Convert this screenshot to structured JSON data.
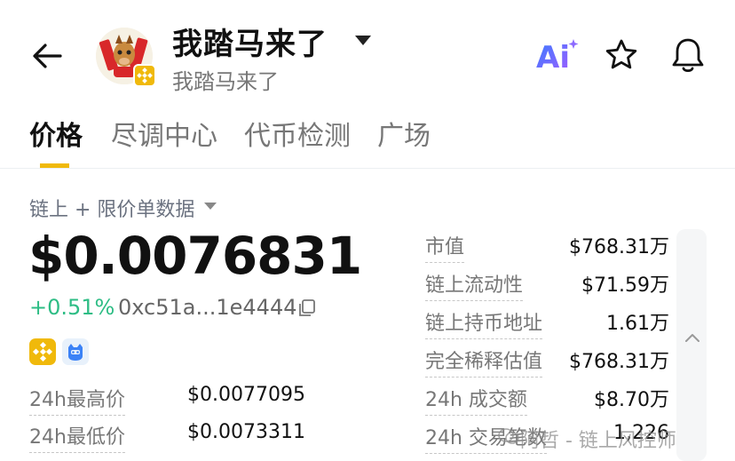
{
  "header": {
    "title": "我踏马来了",
    "subtitle": "我踏马来了",
    "ai_label": "Ai"
  },
  "tabs": [
    {
      "label": "价格",
      "active": true
    },
    {
      "label": "尽调中心",
      "active": false
    },
    {
      "label": "代币检测",
      "active": false
    },
    {
      "label": "广场",
      "active": false
    }
  ],
  "source_label": "链上 + 限价单数据",
  "price": "$0.0076831",
  "change": "+0.51%",
  "address": "0xc51a...1e4444",
  "left_stats": [
    {
      "label": "24h最高价",
      "value": "$0.0077095"
    },
    {
      "label": "24h最低价",
      "value": "$0.0073311"
    }
  ],
  "right_stats": [
    {
      "label": "市值",
      "value": "$768.31万"
    },
    {
      "label": "链上流动性",
      "value": "$71.59万"
    },
    {
      "label": "链上持币地址",
      "value": "1.61万"
    },
    {
      "label": "完全稀释估值",
      "value": "$768.31万"
    },
    {
      "label": "24h 成交额",
      "value": "$8.70万"
    },
    {
      "label": "24h 交易笔数",
      "value": "1,226"
    }
  ],
  "watermark": "阿哲 - 链上风控师",
  "colors": {
    "accent": "#f0b90b",
    "positive": "#2ebd85",
    "ai_gradient_start": "#3a7bff",
    "ai_gradient_end": "#a25cff"
  },
  "icons": [
    "back-arrow-icon",
    "ai-icon",
    "star-icon",
    "bell-icon",
    "copy-icon",
    "chevron-up-icon"
  ]
}
